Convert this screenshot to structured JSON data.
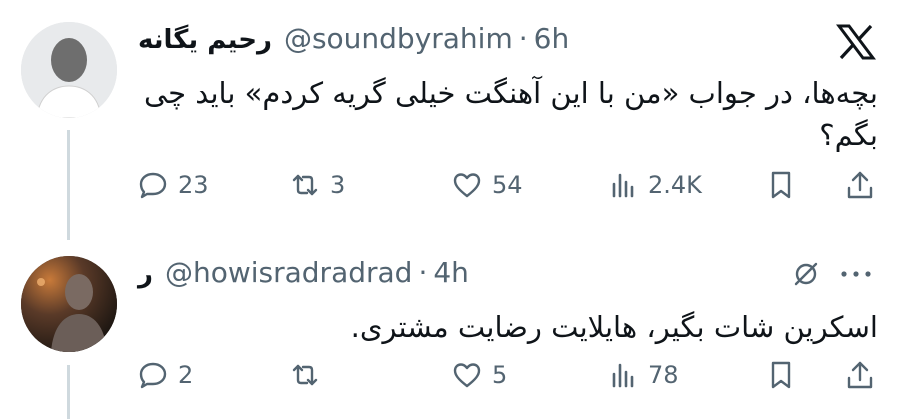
{
  "tweet": {
    "display_name": "رحیم یگانه",
    "handle": "@soundbyrahim",
    "separator": "·",
    "time": "6h",
    "text": "بچه‌ها، در جواب «من با این آهنگت خیلی گریه کردم» باید چی بگم؟",
    "replies": "23",
    "retweets": "3",
    "likes": "54",
    "views": "2.4K"
  },
  "reply": {
    "display_name": "ر",
    "handle": "@howisradradrad",
    "separator": "·",
    "time": "4h",
    "text": "اسکرین شات بگیر، هایلایت رضایت مشتری.",
    "replies": "2",
    "retweets": "",
    "likes": "5",
    "views": "78"
  },
  "icons": {
    "brand": "x-logo-icon",
    "reply": "speech-bubble-icon",
    "retweet": "retweet-icon",
    "like": "heart-icon",
    "views": "bar-chart-icon",
    "bookmark": "bookmark-icon",
    "share": "share-upload-icon",
    "grok": "grok-slash-circle-icon",
    "more": "more-dots-icon"
  },
  "colors": {
    "text": "#0f1419",
    "muted": "#536471",
    "thread_line": "#cfd9de"
  }
}
